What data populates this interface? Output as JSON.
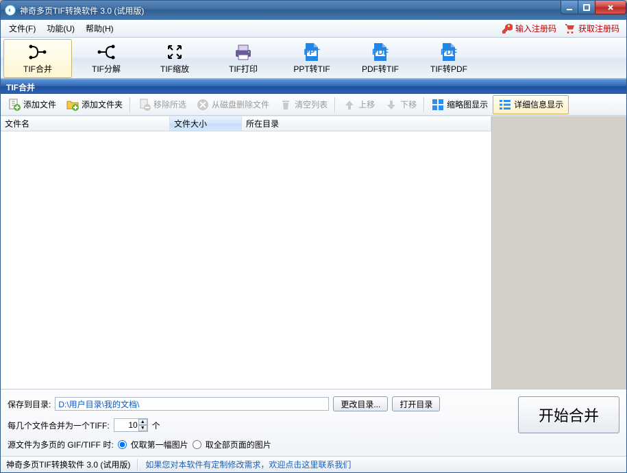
{
  "title": "神奇多页TIF转换软件 3.0 (试用版)",
  "menu": {
    "file": "文件(F)",
    "function": "功能(U)",
    "help": "帮助(H)"
  },
  "reg": {
    "input": "输入注册码",
    "get": "获取注册码"
  },
  "tools": {
    "merge": "TIF合并",
    "split": "TIF分解",
    "scale": "TIF缩放",
    "print": "TIF打印",
    "ppt": "PPT转TIF",
    "pdf2tif": "PDF转TIF",
    "tif2pdf": "TIF转PDF"
  },
  "section_title": "TIF合并",
  "sec_toolbar": {
    "add_file": "添加文件",
    "add_folder": "添加文件夹",
    "remove_sel": "移除所选",
    "delete_disk": "从磁盘删除文件",
    "clear": "清空列表",
    "up": "上移",
    "down": "下移",
    "thumb": "缩略图显示",
    "detail": "详细信息显示"
  },
  "cols": {
    "name": "文件名",
    "size": "文件大小",
    "dir": "所在目录"
  },
  "bottom": {
    "save_to_label": "保存到目录:",
    "save_path": "D:\\用户目录\\我的文档\\",
    "change_dir": "更改目录...",
    "open_dir": "打开目录",
    "every_prefix": "每几个文件合并为一个TIFF:",
    "every_value": "10",
    "every_unit": "个",
    "multipage_label": "源文件为多页的 GIF/TIFF 时:",
    "opt_first": "仅取第一幅图片",
    "opt_all": "取全部页面的图片",
    "start": "开始合并"
  },
  "status": {
    "name": "神奇多页TIF转换软件 3.0 (试用版)",
    "msg": "如果您对本软件有定制修改需求，欢迎点击这里联系我们"
  }
}
